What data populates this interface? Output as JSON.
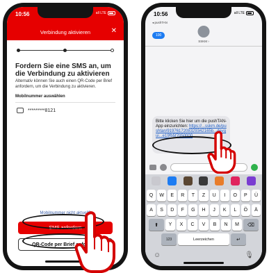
{
  "left_phone": {
    "status_time": "10:56",
    "status_signal": "all LTE",
    "header_title": "Verbindung aktivieren",
    "close_glyph": "✕",
    "heading": "Fordern Sie eine SMS an, um die Verbindung zu aktivieren",
    "subtext": "Alternativ können Sie auch einen QR-Code per Brief anfordern, um die Verbindung zu aktivieren.",
    "mobile_label": "Mobilnummer auswählen",
    "masked_number": "*********8121",
    "link_not_current": "Mobilnummer nicht aktuell?",
    "sms_button": "SMS anfordern",
    "qr_button": "QR-Code per Brief anfordern"
  },
  "right_phone": {
    "status_time": "10:56",
    "back_app": "◂ pushTAN",
    "back_badge": "100",
    "contact_name": "SSKM ›",
    "message_text": "Bitte klicken Sie hier um die pushTAN-App einzurichten: ",
    "message_url": "https://...sskm.de/pushtan/9197617208329342165b...devgui...e19fb5f7050000",
    "keyboard_rows": [
      [
        "Q",
        "W",
        "E",
        "R",
        "T",
        "Z",
        "U",
        "I",
        "O",
        "P",
        "Ü"
      ],
      [
        "A",
        "S",
        "D",
        "F",
        "G",
        "H",
        "J",
        "K",
        "L",
        "Ö",
        "Ä"
      ],
      [
        "Y",
        "X",
        "C",
        "V",
        "B",
        "N",
        "M"
      ]
    ],
    "key_numbers": "123",
    "key_space": "Leerzeichen",
    "key_return": "↵",
    "key_shift": "⬆",
    "key_delete": "⌫",
    "emoji_icon": "☺",
    "mic_icon": "🎙"
  },
  "colors": {
    "brand_red": "#e60000",
    "ios_blue": "#1d7cf2",
    "send_green": "#2fb24c"
  },
  "icons": [
    "close-icon",
    "message-icon",
    "camera-icon",
    "appstore-icon",
    "send-icon",
    "emoji-icon",
    "microphone-icon",
    "pointing-hand-icon"
  ]
}
